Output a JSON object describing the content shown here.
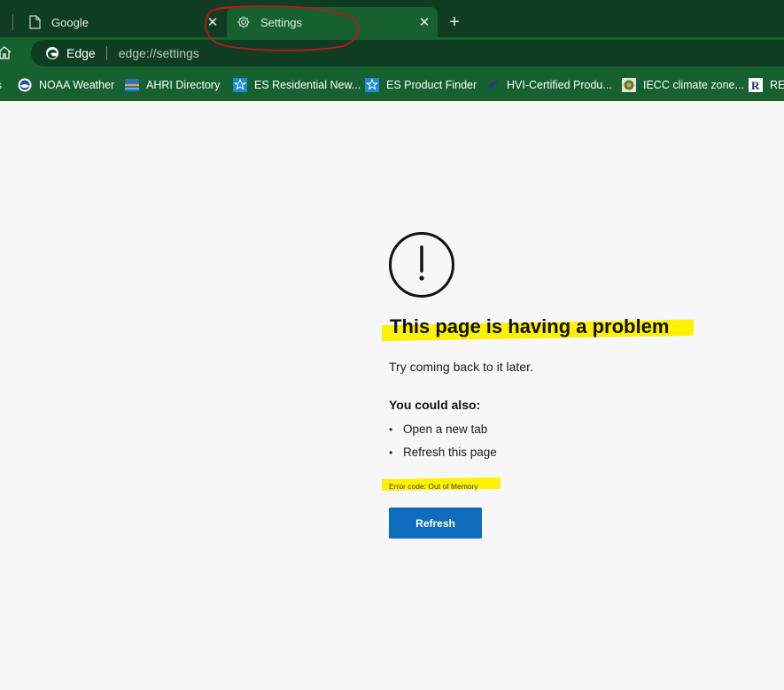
{
  "browser": {
    "tabs": [
      {
        "label": "Google",
        "icon": "page-icon"
      },
      {
        "label": "Settings",
        "icon": "gear-icon"
      }
    ],
    "omnibox": {
      "site": "Edge",
      "url": "edge://settings"
    },
    "favorites": [
      {
        "label": "NOAA Weather",
        "icon": "noaa-icon"
      },
      {
        "label": "AHRI  Directory",
        "icon": "ahri-icon"
      },
      {
        "label": "ES Residential New...",
        "icon": "energy-star-icon"
      },
      {
        "label": "ES Product Finder",
        "icon": "energy-star-icon"
      },
      {
        "label": "HVI-Certified Produ...",
        "icon": "hvi-icon"
      },
      {
        "label": "IECC climate zone...",
        "icon": "iecc-icon"
      },
      {
        "label": "RES",
        "icon": "resnet-icon"
      }
    ]
  },
  "error_page": {
    "title": "This page is having a problem",
    "subtitle": "Try coming back to it later.",
    "also_heading": "You could also:",
    "options": [
      "Open a new tab",
      "Refresh this page"
    ],
    "error_code": "Error code: Out of Memory",
    "button_label": "Refresh"
  },
  "colors": {
    "tabbar_bg": "#0f3d22",
    "toolbar_bg": "#16612f",
    "highlight": "#fff200",
    "annotation_circle": "#c0141c",
    "button_bg": "#0f6cbd"
  }
}
